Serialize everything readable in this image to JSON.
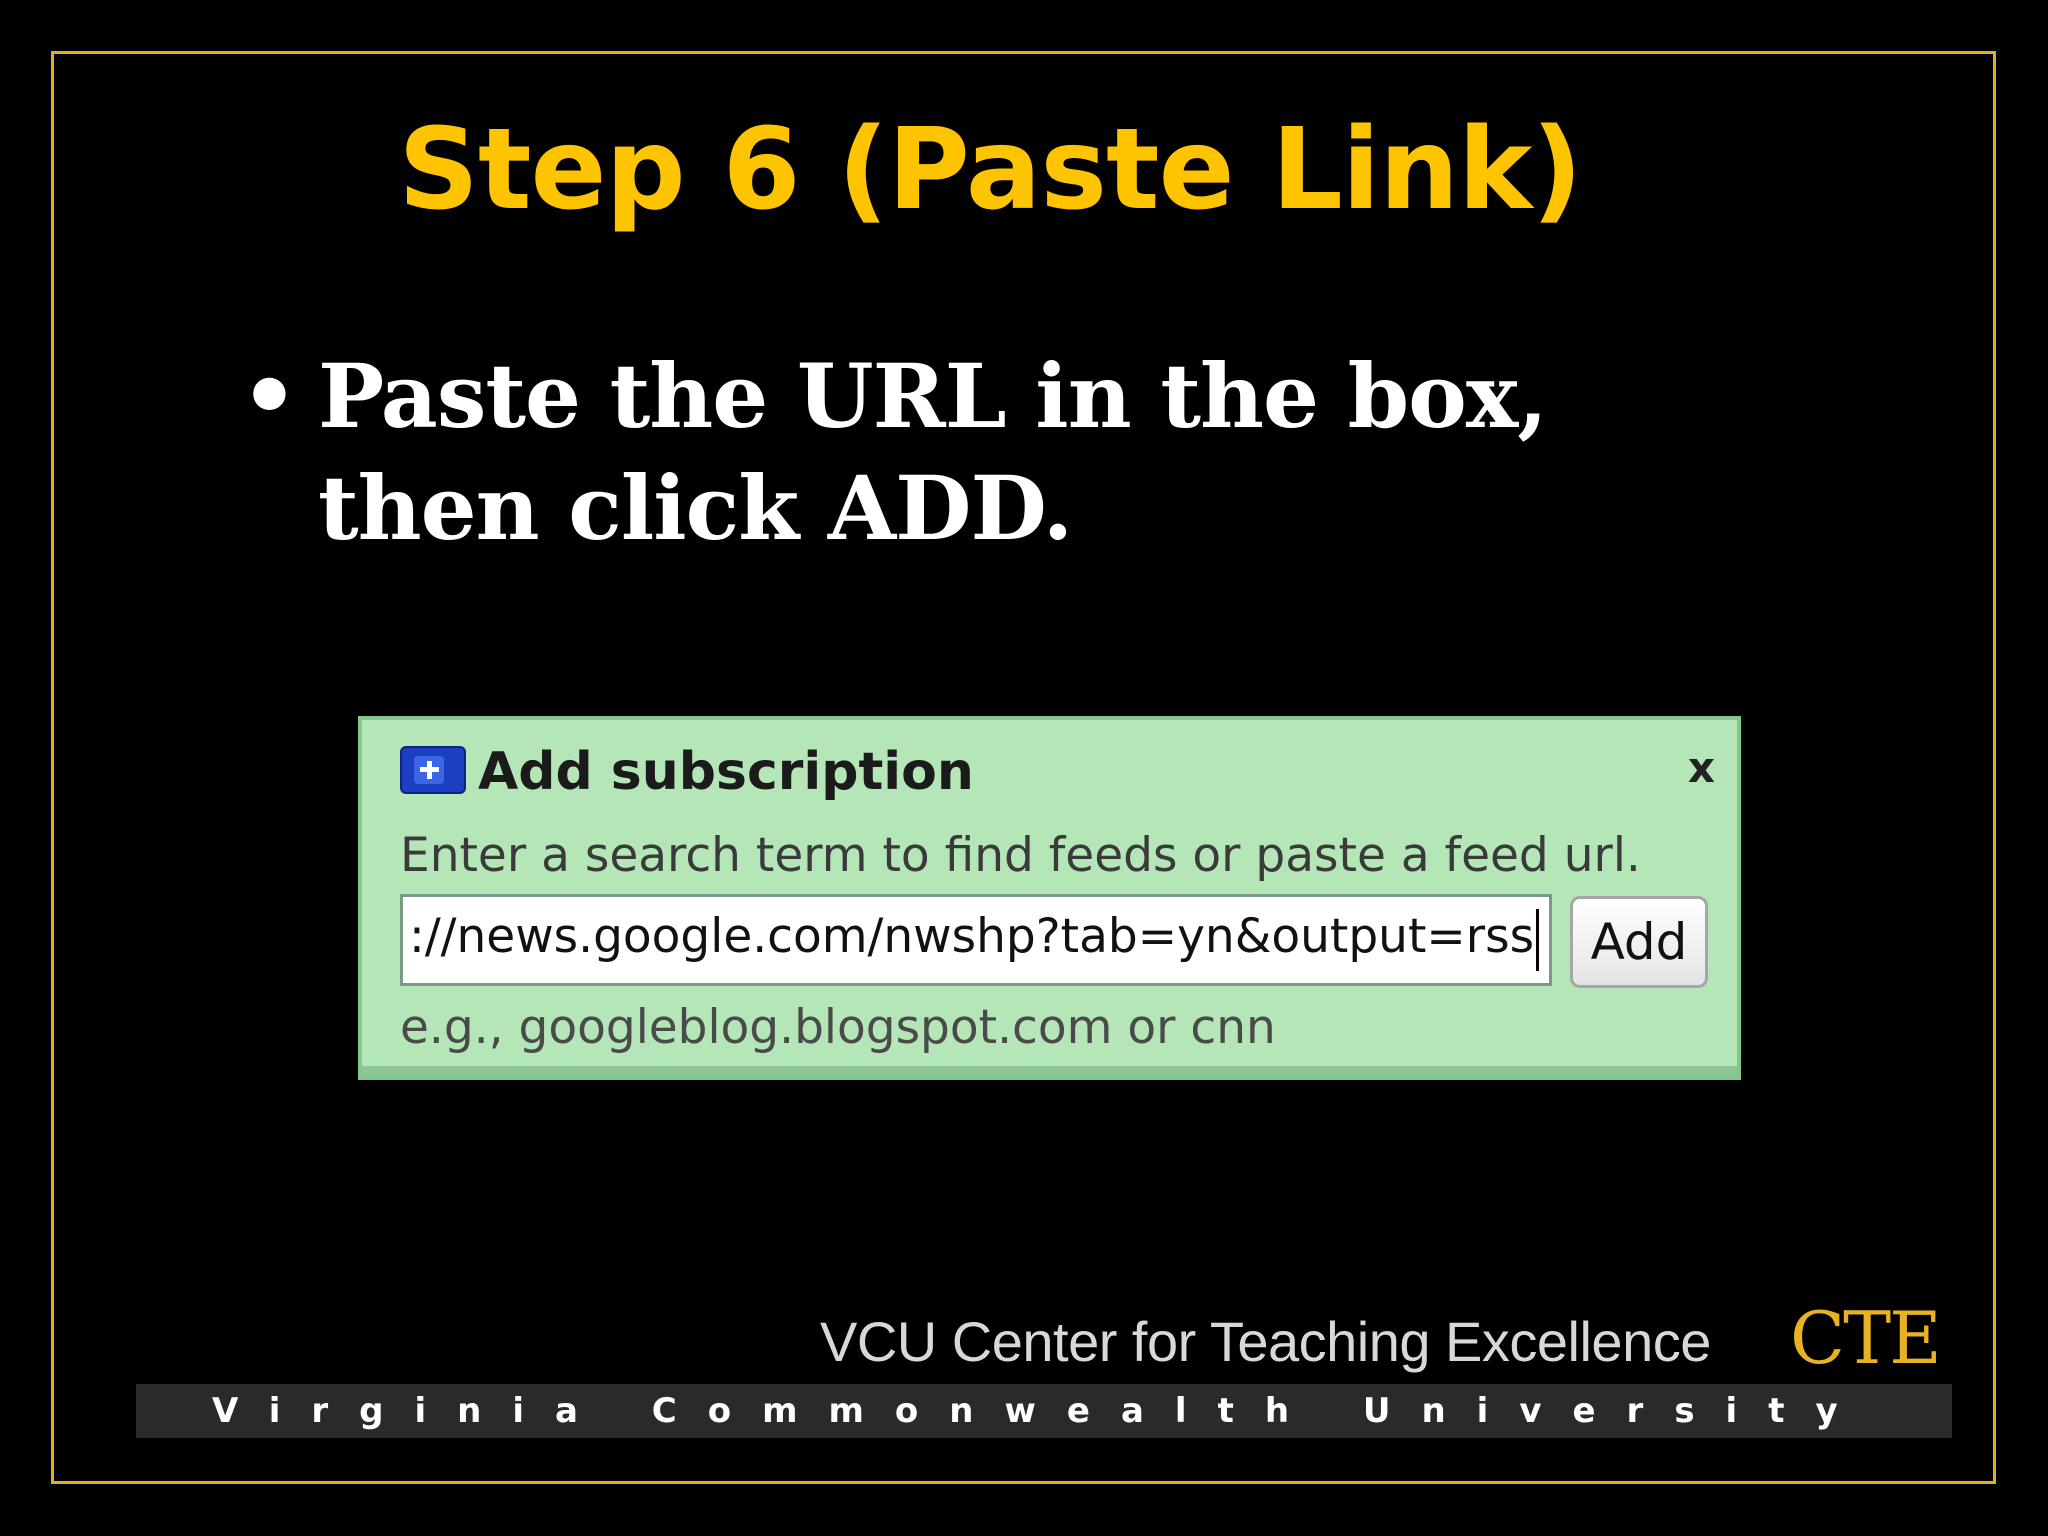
{
  "slide": {
    "title": "Step 6 (Paste Link)",
    "bullet_symbol": "•",
    "bullet_text": "Paste the URL in the box, then click ADD."
  },
  "dialog": {
    "title": "Add subscription",
    "close_symbol": "x",
    "description": "Enter a search term to find feeds or paste a feed url.",
    "input_value": "://news.google.com/nwshp?tab=yn&output=rss",
    "add_label": "Add",
    "example": "e.g., googleblog.blogspot.com or cnn",
    "icon": "plus-icon"
  },
  "footer": {
    "center_name": "VCU Center for Teaching Excellence",
    "logo_text": "CTE",
    "university": "Virginia Commonwealth University"
  },
  "colors": {
    "background": "#000000",
    "title": "#FFC400",
    "frame": "#E0B21A",
    "dialog_bg": "#B4E6B8"
  }
}
